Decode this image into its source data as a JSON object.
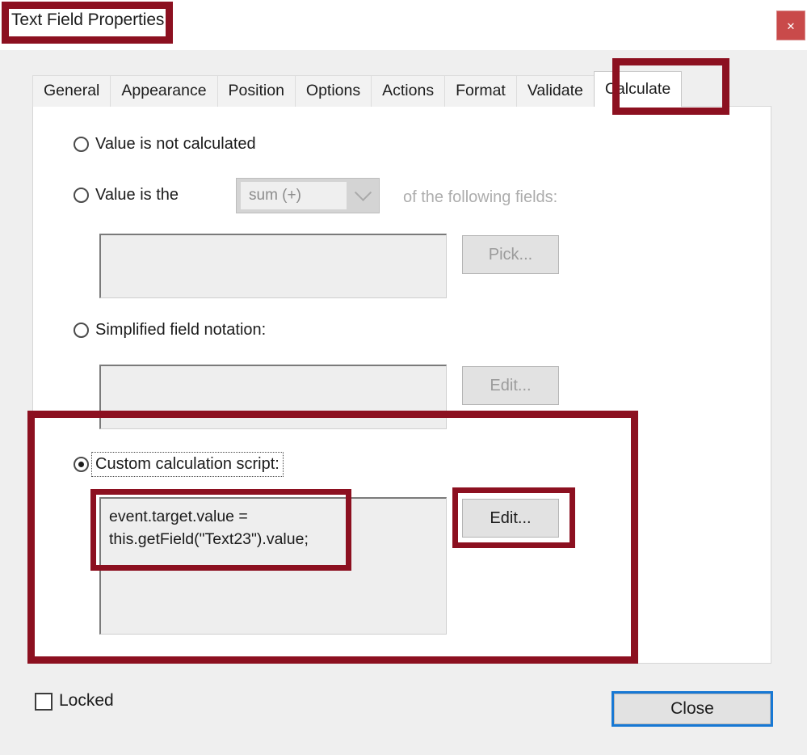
{
  "window": {
    "title": "Text Field Properties",
    "close_icon": "close-icon",
    "close_glyph": "✕"
  },
  "tabs": [
    {
      "label": "General",
      "active": false
    },
    {
      "label": "Appearance",
      "active": false
    },
    {
      "label": "Position",
      "active": false
    },
    {
      "label": "Options",
      "active": false
    },
    {
      "label": "Actions",
      "active": false
    },
    {
      "label": "Format",
      "active": false
    },
    {
      "label": "Validate",
      "active": false
    },
    {
      "label": "Calculate",
      "active": true
    }
  ],
  "calculate": {
    "option_not_calculated": "Value is not calculated",
    "option_value_is_the": "Value is the",
    "operation_selected": "sum (+)",
    "operation_suffix": "of the following fields:",
    "fields_value": "",
    "pick_button": "Pick...",
    "option_simplified": "Simplified field notation:",
    "simplified_value": "",
    "simplified_edit_button": "Edit...",
    "option_custom_script": "Custom calculation script:",
    "custom_script_value": "event.target.value =\nthis.getField(\"Text23\").value;",
    "custom_script_edit_button": "Edit..."
  },
  "footer": {
    "locked_label": "Locked",
    "locked_checked": false,
    "close_button": "Close"
  },
  "annotations": {
    "color": "#8C1020",
    "highlight_title": "Text Field Properties",
    "highlight_tab": "Calculate",
    "highlight_section": "Custom calculation script section",
    "highlight_script_text": "event.target.value = this.getField(\"Text23\").value;",
    "highlight_edit_button": "Edit..."
  }
}
